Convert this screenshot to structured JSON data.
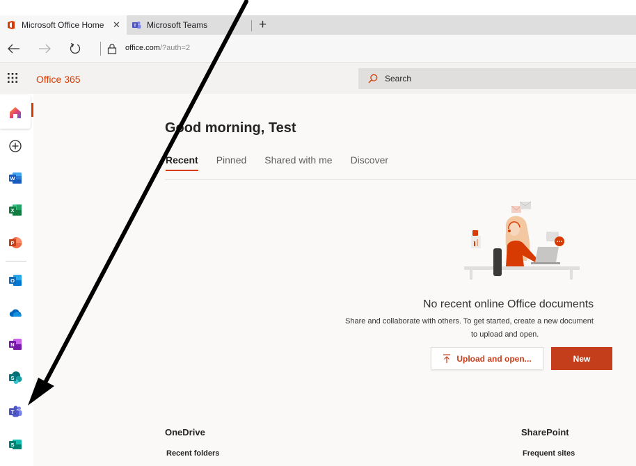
{
  "browser": {
    "tabs": [
      {
        "title": "Microsoft Office Home",
        "active": true
      },
      {
        "title": "Microsoft Teams",
        "active": false
      }
    ],
    "close_glyph": "✕",
    "new_tab_glyph": "+",
    "url": {
      "host": "office.com",
      "path": "/?auth=2"
    }
  },
  "header": {
    "brand": "Office 365",
    "search_placeholder": "Search"
  },
  "rail": {
    "items": [
      {
        "name": "home-icon",
        "active": true
      },
      {
        "name": "create-icon"
      },
      {
        "name": "word-icon",
        "letter": "W",
        "color": "#185abd"
      },
      {
        "name": "excel-icon",
        "letter": "X",
        "color": "#107c41"
      },
      {
        "name": "powerpoint-icon",
        "letter": "P",
        "color": "#c43e1c"
      },
      {
        "name": "outlook-icon",
        "letter": "O",
        "color": "#0f6cbd"
      },
      {
        "name": "onedrive-icon",
        "color": "#0364b8"
      },
      {
        "name": "onenote-icon",
        "letter": "N",
        "color": "#7719aa"
      },
      {
        "name": "sharepoint-icon",
        "letter": "S",
        "color": "#03787c"
      },
      {
        "name": "teams-icon",
        "letter": "T",
        "color": "#5b5fc7"
      },
      {
        "name": "sway-icon",
        "letter": "S",
        "color": "#008272"
      }
    ]
  },
  "main": {
    "greeting": "Good morning, Test",
    "tabs": [
      {
        "label": "Recent",
        "selected": true
      },
      {
        "label": "Pinned"
      },
      {
        "label": "Shared with me"
      },
      {
        "label": "Discover"
      }
    ],
    "empty_state": {
      "title": "No recent online Office documents",
      "desc_line1": "Share and collaborate with others. To get started, create a new document",
      "desc_line2": "to upload and open.",
      "upload_label": "Upload and open...",
      "new_label": "New"
    },
    "onedrive": {
      "title": "OneDrive",
      "subtitle": "Recent folders"
    },
    "sharepoint": {
      "title": "SharePoint",
      "subtitle": "Frequent sites"
    }
  },
  "colors": {
    "accent": "#d83b01",
    "button_primary": "#c43e1c",
    "suite_bar": "#f3f2f1",
    "page_bg": "#faf9f8"
  }
}
